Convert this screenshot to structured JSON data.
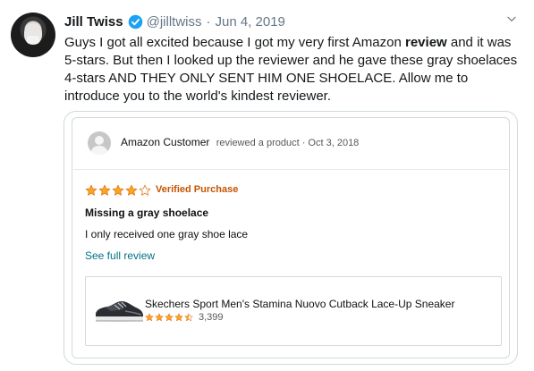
{
  "tweet": {
    "author_name": "Jill Twiss",
    "handle": "@jilltwiss",
    "separator": "·",
    "date": "Jun 4, 2019",
    "text_before": "Guys I got all excited because I got my very first Amazon ",
    "text_bold": "review",
    "text_after": " and it was 5-stars. But then I looked up the reviewer and he gave these gray shoelaces 4-stars AND THEY ONLY SENT HIM ONE SHOELACE. Allow me to introduce you to the world's kindest reviewer."
  },
  "review": {
    "reviewer_name": "Amazon Customer",
    "reviewer_meta": "reviewed a product · Oct 3, 2018",
    "rating": 4,
    "rating_max": 5,
    "verified_label": "Verified Purchase",
    "title": "Missing a gray shoelace",
    "body": "I only received one gray shoe lace",
    "see_full_label": "See full review"
  },
  "product": {
    "name": "Skechers Sport Men's Stamina Nuovo Cutback Lace-Up Sneaker",
    "rating": 4.5,
    "rating_count": "3,399"
  },
  "colors": {
    "twitter_blue": "#1da1f2",
    "star_orange": "#ffa41c",
    "verified_orange": "#c45500",
    "link_teal": "#007185"
  },
  "icons": {
    "verified": "verified-badge-icon",
    "more": "chevron-down-icon",
    "reviewer": "default-user-icon",
    "star": "star-icon"
  }
}
